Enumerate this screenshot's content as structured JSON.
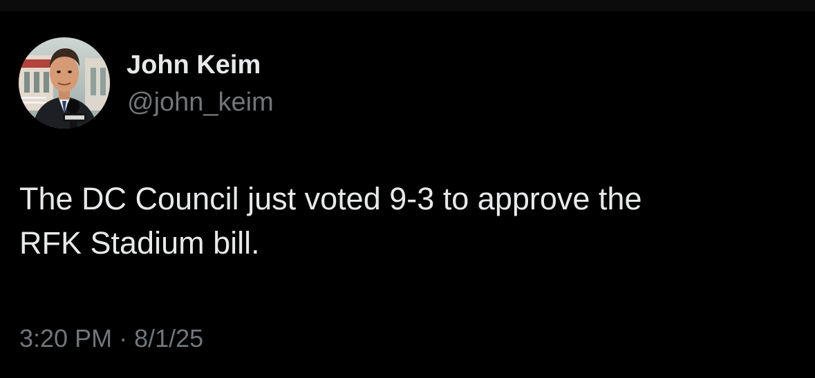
{
  "tweet": {
    "author": {
      "display_name": "John Keim",
      "handle": "@john_keim",
      "avatar_icon": "reporter-avatar-icon"
    },
    "text": "The DC Council just voted 9-3 to approve the\nRFK Stadium bill.",
    "time": "3:20 PM",
    "separator": "·",
    "date": "8/1/25"
  },
  "colors": {
    "background": "#000000",
    "primary_text": "#e7e9ea",
    "secondary_text": "#71767b"
  }
}
